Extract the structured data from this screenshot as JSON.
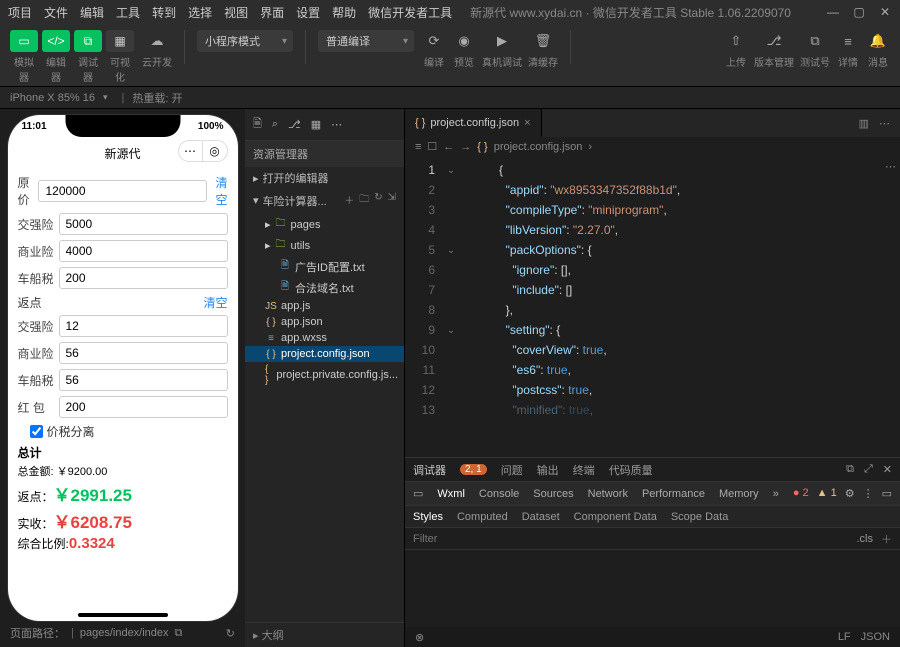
{
  "menu": {
    "items": [
      "项目",
      "文件",
      "编辑",
      "工具",
      "转到",
      "选择",
      "视图",
      "界面",
      "设置",
      "帮助",
      "微信开发者工具"
    ],
    "title": "新源代 www.xydai.cn  ·  微信开发者工具 Stable 1.06.2209070"
  },
  "toolbar": {
    "seg1": [
      "模拟器",
      "编辑器",
      "调试器",
      "可视化"
    ],
    "cloud": "云开发",
    "modeSelect": "小程序模式",
    "compileSelect": "普通编译",
    "actions": [
      "编译",
      "预览",
      "真机调试",
      "清缓存"
    ],
    "right": [
      "上传",
      "版本管理",
      "测试号",
      "详情",
      "消息"
    ]
  },
  "subbar": {
    "device": "iPhone X 85% 16",
    "hot": "热重载: 开"
  },
  "sim": {
    "time": "11:01",
    "battery": "100%",
    "appTitle": "新源代",
    "f": {
      "origLabel": "原价",
      "origVal": "120000",
      "clear": "清空",
      "jqLabel": "交强险",
      "jqVal": "5000",
      "syLabel": "商业险",
      "syVal": "4000",
      "ccLabel": "车船税",
      "ccVal": "200"
    },
    "rebateHdr": "返点",
    "r": {
      "jqLabel": "交强险",
      "jqVal": "12",
      "syLabel": "商业险",
      "syVal": "56",
      "ccLabel": "车船税",
      "ccVal": "56",
      "hbLabel": "红 包",
      "hbVal": "200"
    },
    "chk": "价税分离",
    "totals": {
      "hdr": "总计",
      "sum": "总金额: ￥9200.00",
      "rebateL": "返点：",
      "rebateV": "￥2991.25",
      "netL": "实收：",
      "netV": "￥6208.75",
      "ratioL": "综合比例:",
      "ratioV": "0.3324"
    },
    "footer": {
      "pathLabel": "页面路径：",
      "path": "pages/index/index"
    }
  },
  "explorer": {
    "header": "资源管理器",
    "openEditors": "打开的编辑器",
    "project": "车险计算器...",
    "tree": [
      {
        "t": "folder",
        "name": "pages",
        "depth": 1
      },
      {
        "t": "folder",
        "name": "utils",
        "depth": 1
      },
      {
        "t": "txt",
        "name": "广告ID配置.txt",
        "depth": 2
      },
      {
        "t": "txt",
        "name": "合法域名.txt",
        "depth": 2
      },
      {
        "t": "js",
        "name": "app.js",
        "depth": 1
      },
      {
        "t": "json",
        "name": "app.json",
        "depth": 1
      },
      {
        "t": "wxss",
        "name": "app.wxss",
        "depth": 1
      },
      {
        "t": "json",
        "name": "project.config.json",
        "depth": 1,
        "sel": true
      },
      {
        "t": "json",
        "name": "project.private.config.js...",
        "depth": 1
      }
    ],
    "outline": "大纲"
  },
  "editor": {
    "tab": "project.config.json",
    "crumb": "project.config.json",
    "lines": [
      {
        "n": 1,
        "raw": "{"
      },
      {
        "n": 2,
        "k": "appid",
        "v": "\"wx8953347352f88b1d\"",
        "c": ","
      },
      {
        "n": 3,
        "k": "compileType",
        "v": "\"miniprogram\"",
        "c": ","
      },
      {
        "n": 4,
        "k": "libVersion",
        "v": "\"2.27.0\"",
        "c": ","
      },
      {
        "n": 5,
        "k": "packOptions",
        "v": "{",
        "c": ""
      },
      {
        "n": 6,
        "k": "ignore",
        "v": "[]",
        "c": ",",
        "indent": 2
      },
      {
        "n": 7,
        "k": "include",
        "v": "[]",
        "c": "",
        "indent": 2
      },
      {
        "n": 8,
        "raw": "  },"
      },
      {
        "n": 9,
        "k": "setting",
        "v": "{",
        "c": ""
      },
      {
        "n": 10,
        "k": "coverView",
        "v": "true",
        "c": ",",
        "indent": 2,
        "kw": true
      },
      {
        "n": 11,
        "k": "es6",
        "v": "true",
        "c": ",",
        "indent": 2,
        "kw": true
      },
      {
        "n": 12,
        "k": "postcss",
        "v": "true",
        "c": ",",
        "indent": 2,
        "kw": true
      },
      {
        "n": 13,
        "k": "minified",
        "v": "true",
        "c": ",",
        "indent": 2,
        "kw": true,
        "cut": true
      }
    ]
  },
  "debug": {
    "title": "调试器",
    "badge": "2, 1",
    "tabs": [
      "问题",
      "输出",
      "终端",
      "代码质量"
    ],
    "devtabs": [
      "Wxml",
      "Console",
      "Sources",
      "Network",
      "Performance",
      "Memory"
    ],
    "err": "2",
    "warn": "1",
    "styletabs": [
      "Styles",
      "Computed",
      "Dataset",
      "Component Data",
      "Scope Data"
    ],
    "filter": "Filter",
    "cls": ".cls"
  },
  "status": {
    "lf": "LF",
    "lang": "JSON"
  }
}
